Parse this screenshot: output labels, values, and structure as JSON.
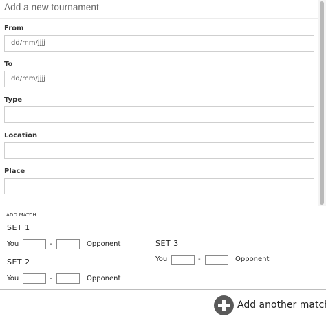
{
  "form": {
    "title": "Add a new tournament",
    "fields": [
      {
        "label": "From",
        "value": "",
        "placeholder": "dd/mm/jjjj"
      },
      {
        "label": "To",
        "value": "",
        "placeholder": "dd/mm/jjjj"
      },
      {
        "label": "Type",
        "value": "",
        "placeholder": ""
      },
      {
        "label": "Location",
        "value": "",
        "placeholder": ""
      },
      {
        "label": "Place",
        "value": "",
        "placeholder": ""
      }
    ]
  },
  "add_match": {
    "legend": "ADD MATCH",
    "sets": [
      {
        "label": "SET 1",
        "you_label": "You",
        "separator": "-",
        "opponent_label": "Opponent",
        "you_score": "",
        "opponent_score": ""
      },
      {
        "label": "SET 2",
        "you_label": "You",
        "separator": "-",
        "opponent_label": "Opponent",
        "you_score": "",
        "opponent_score": ""
      },
      {
        "label": "SET 3",
        "you_label": "You",
        "separator": "-",
        "opponent_label": "Opponent",
        "you_score": "",
        "opponent_score": ""
      }
    ],
    "add_button_label": "Add another match",
    "add_icon": "plus-circle-icon"
  }
}
